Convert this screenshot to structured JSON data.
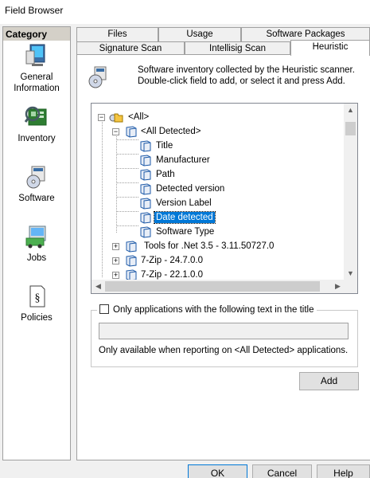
{
  "window": {
    "title": "Field Browser"
  },
  "category": {
    "header": "Category",
    "items": [
      {
        "label": "General Information",
        "icon": "computer-icon"
      },
      {
        "label": "Inventory",
        "icon": "inventory-icon"
      },
      {
        "label": "Software",
        "icon": "software-icon"
      },
      {
        "label": "Jobs",
        "icon": "jobs-icon"
      },
      {
        "label": "Policies",
        "icon": "policies-icon"
      }
    ],
    "selected": "Software"
  },
  "tabs": {
    "row1": [
      "Files",
      "Usage",
      "Software Packages"
    ],
    "row2": [
      "Signature Scan",
      "Intellisig Scan",
      "Heuristic"
    ],
    "active": "Heuristic"
  },
  "info": {
    "line1": "Software inventory collected by the Heuristic scanner.",
    "line2": "Double-click field to add, or select it and press Add."
  },
  "tree": {
    "root": "<All>",
    "group": "<All Detected>",
    "fields": [
      "Title",
      "Manufacturer",
      "Path",
      "Detected version",
      "Version Label",
      "Date detected",
      "Software Type"
    ],
    "selected_field": "Date detected",
    "apps": [
      "Tools for .Net 3.5 - 3.11.50727.0",
      "7-Zip - 24.7.0.0",
      "7-Zip - 22.1.0.0"
    ]
  },
  "filter": {
    "checkbox_label": "Only applications with the following text in the title",
    "checked": false,
    "input_value": "",
    "note": "Only available when reporting on <All Detected> applications."
  },
  "buttons": {
    "add": "Add",
    "ok": "OK",
    "cancel": "Cancel",
    "help": "Help"
  }
}
